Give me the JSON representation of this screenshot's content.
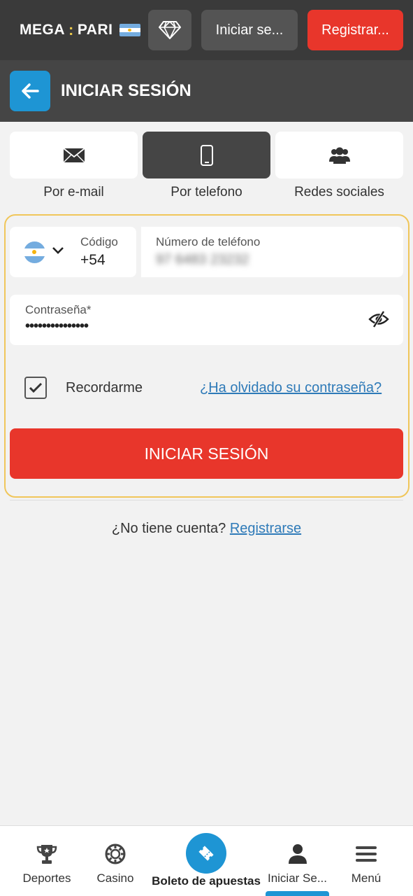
{
  "topbar": {
    "logo_left": "MEGA",
    "logo_sep": ":",
    "logo_right": "PARI",
    "login_label": "Iniciar se...",
    "register_label": "Registrar..."
  },
  "header": {
    "title": "INICIAR SESIÓN"
  },
  "tabs": [
    {
      "label": "Por e-mail",
      "icon": "envelope-icon"
    },
    {
      "label": "Por telefono",
      "icon": "phone-icon",
      "active": true
    },
    {
      "label": "Redes sociales",
      "icon": "users-icon"
    }
  ],
  "form": {
    "code_label": "Código",
    "code_value": "+54",
    "phone_label": "Número de teléfono",
    "phone_value": "97 6483 23232",
    "password_label": "Contraseña*",
    "password_value": "•••••••••••••••",
    "remember_label": "Recordarme",
    "remember_checked": true,
    "forgot_link": "¿Ha olvidado su contraseña?",
    "submit_label": "INICIAR SESIÓN"
  },
  "footer": {
    "no_account": "¿No tiene cuenta?",
    "register_link": "Registrarse"
  },
  "bottom_nav": {
    "items": [
      {
        "label": "Deportes",
        "icon": "trophy-icon"
      },
      {
        "label": "Casino",
        "icon": "chip-icon"
      },
      {
        "label": "Boleto de apuestas",
        "icon": "ticket-icon"
      },
      {
        "label": "Iniciar Se...",
        "icon": "user-icon",
        "active": true
      },
      {
        "label": "Menú",
        "icon": "menu-icon"
      }
    ]
  },
  "colors": {
    "accent_red": "#e8362b",
    "accent_blue": "#1e95d4",
    "highlight_border": "#f0c65a"
  }
}
